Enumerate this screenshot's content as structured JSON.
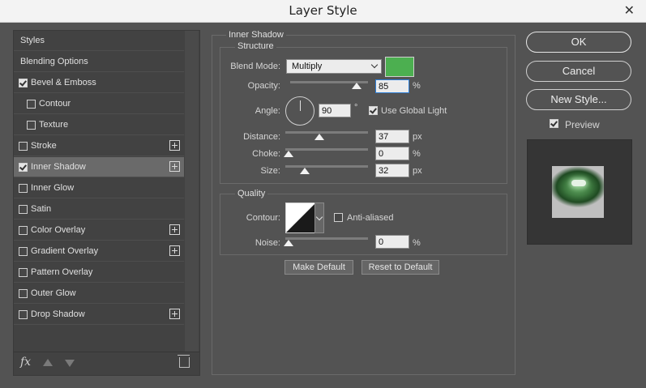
{
  "window": {
    "title": "Layer Style",
    "close_glyph": "✕"
  },
  "styles_list": [
    {
      "label": "Styles",
      "checkbox": null,
      "add": false,
      "indent": 0,
      "selected": false
    },
    {
      "label": "Blending Options",
      "checkbox": null,
      "add": false,
      "indent": 0,
      "selected": false
    },
    {
      "label": "Bevel & Emboss",
      "checkbox": true,
      "add": false,
      "indent": 0,
      "selected": false
    },
    {
      "label": "Contour",
      "checkbox": false,
      "add": false,
      "indent": 1,
      "selected": false
    },
    {
      "label": "Texture",
      "checkbox": false,
      "add": false,
      "indent": 1,
      "selected": false
    },
    {
      "label": "Stroke",
      "checkbox": false,
      "add": true,
      "indent": 0,
      "selected": false
    },
    {
      "label": "Inner Shadow",
      "checkbox": true,
      "add": true,
      "indent": 0,
      "selected": true
    },
    {
      "label": "Inner Glow",
      "checkbox": false,
      "add": false,
      "indent": 0,
      "selected": false
    },
    {
      "label": "Satin",
      "checkbox": false,
      "add": false,
      "indent": 0,
      "selected": false
    },
    {
      "label": "Color Overlay",
      "checkbox": false,
      "add": true,
      "indent": 0,
      "selected": false
    },
    {
      "label": "Gradient Overlay",
      "checkbox": false,
      "add": true,
      "indent": 0,
      "selected": false
    },
    {
      "label": "Pattern Overlay",
      "checkbox": false,
      "add": false,
      "indent": 0,
      "selected": false
    },
    {
      "label": "Outer Glow",
      "checkbox": false,
      "add": false,
      "indent": 0,
      "selected": false
    },
    {
      "label": "Drop Shadow",
      "checkbox": false,
      "add": true,
      "indent": 0,
      "selected": false
    }
  ],
  "list_footer": {
    "fx_label": "fx",
    "icons": [
      "fx-icon",
      "move-up-icon",
      "move-down-icon",
      "trash-icon"
    ]
  },
  "inner_shadow": {
    "section_title": "Inner Shadow",
    "structure_title": "Structure",
    "blend_mode_label": "Blend Mode:",
    "blend_mode_value": "Multiply",
    "shadow_color": "#4caf50",
    "opacity_label": "Opacity:",
    "opacity_value": "85",
    "opacity_unit": "%",
    "opacity_fraction": 0.85,
    "angle_label": "Angle:",
    "angle_value": "90",
    "angle_unit": "°",
    "use_global_light_label": "Use Global Light",
    "use_global_light": true,
    "distance_label": "Distance:",
    "distance_value": "37",
    "distance_unit": "px",
    "choke_label": "Choke:",
    "choke_value": "0",
    "choke_unit": "%",
    "size_label": "Size:",
    "size_value": "32",
    "size_unit": "px",
    "quality_title": "Quality",
    "contour_label": "Contour:",
    "anti_aliased_label": "Anti-aliased",
    "anti_aliased": false,
    "noise_label": "Noise:",
    "noise_value": "0",
    "noise_unit": "%",
    "make_default_label": "Make Default",
    "reset_default_label": "Reset to Default"
  },
  "actions": {
    "ok_label": "OK",
    "cancel_label": "Cancel",
    "new_style_label": "New Style...",
    "preview_label": "Preview",
    "preview_checked": true
  }
}
